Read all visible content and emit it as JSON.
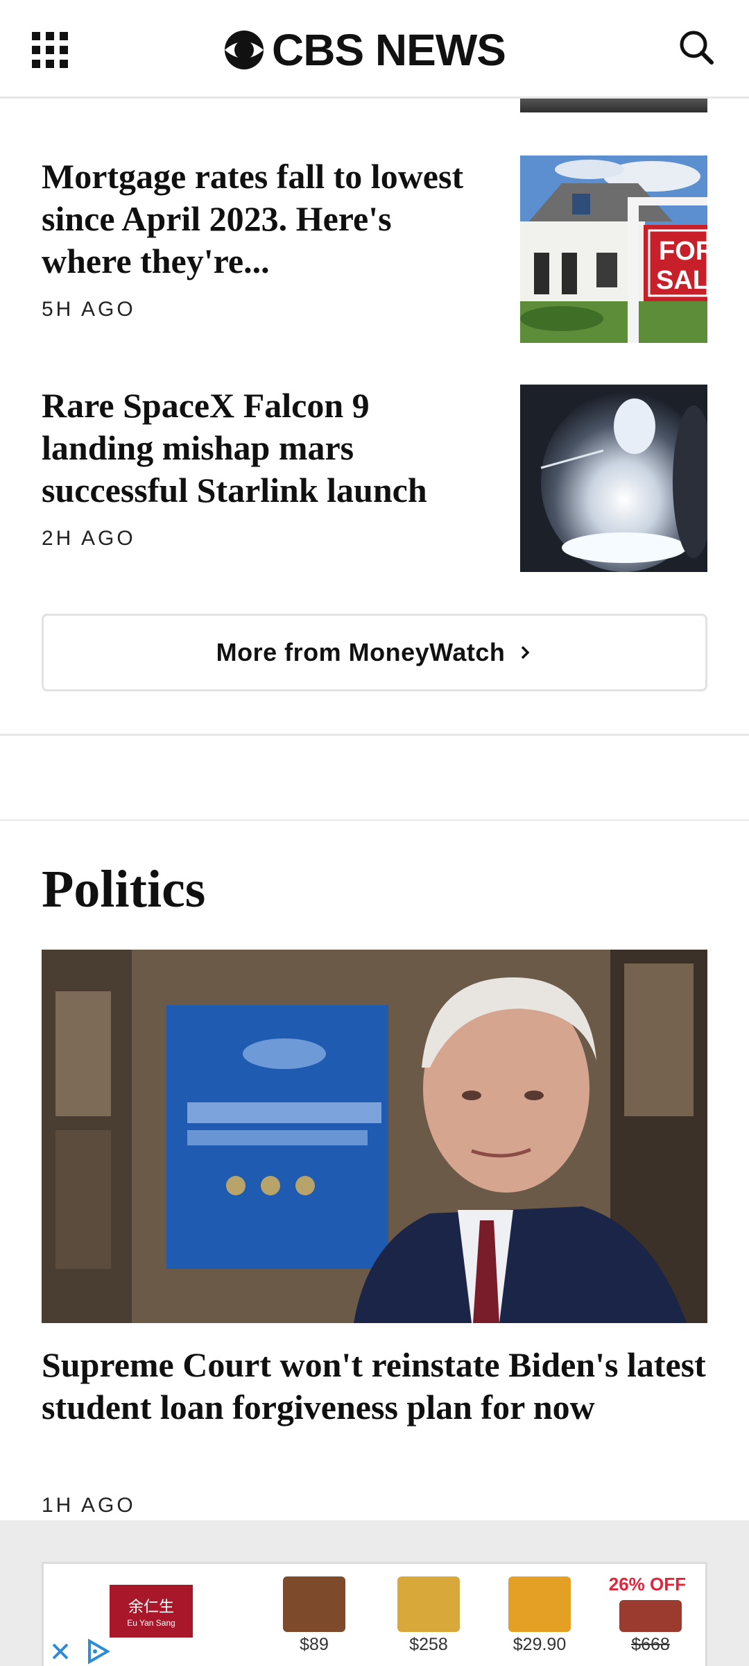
{
  "header": {
    "logo_text": "CBS NEWS",
    "menu_icon": "grid-menu-icon",
    "search_icon": "search-icon"
  },
  "stories": [
    {
      "title": "Mortgage rates fall to lowest since April 2023. Here's where they're...",
      "time": "5H AGO",
      "image": "house-for-sale-sign"
    },
    {
      "title": "Rare SpaceX Falcon 9 landing mishap mars successful Starlink launch",
      "time": "2H AGO",
      "image": "rocket-launch-night"
    }
  ],
  "more_button": {
    "label": "More from MoneyWatch"
  },
  "politics": {
    "section_title": "Politics",
    "lead": {
      "title": "Supreme Court won't reinstate Biden's latest student loan forgiveness plan for now",
      "time": "1H AGO",
      "image": "biden-portrait"
    }
  },
  "ad": {
    "brand_cn": "余仁生",
    "brand_en": "Eu Yan Sang",
    "discount": "26% OFF",
    "prices": [
      "$89",
      "$258",
      "$29.90",
      "$668"
    ],
    "colors": {
      "brand": "#a8172a",
      "discount": "#e3243b"
    }
  }
}
